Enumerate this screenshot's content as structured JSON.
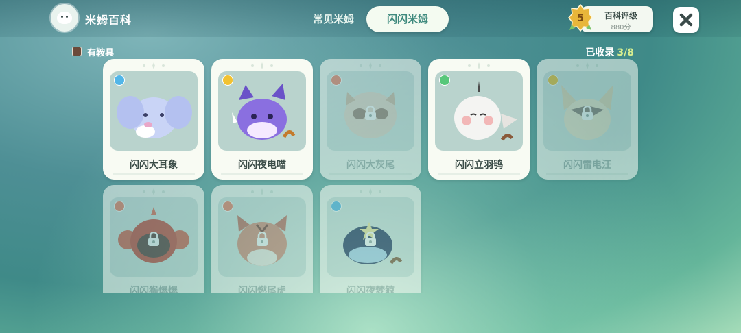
{
  "header": {
    "avatar_icon": "cat-avatar-icon",
    "title": "米姆百科",
    "tabs": [
      {
        "label": "常见米姆",
        "active": false
      },
      {
        "label": "闪闪米姆",
        "active": true
      }
    ],
    "rating": {
      "badge_level": "5",
      "label": "百科评级",
      "score": "880分"
    },
    "close_icon": "close-icon"
  },
  "filter": {
    "label": "有鞍具",
    "checked": true
  },
  "collection": {
    "label": "已收录",
    "count": "3/8"
  },
  "colors": {
    "water": "#52b6e8",
    "electric": "#f2c232",
    "fire": "#ef7f62",
    "grass": "#57c77a"
  },
  "cards": [
    {
      "name": "闪闪大耳象",
      "element": "water",
      "locked": false
    },
    {
      "name": "闪闪夜电喵",
      "element": "electric",
      "locked": false
    },
    {
      "name": "闪闪大灰尾",
      "element": "fire",
      "locked": true
    },
    {
      "name": "闪闪立羽鸮",
      "element": "grass",
      "locked": false
    },
    {
      "name": "闪闪雷电汪",
      "element": "electric",
      "locked": true
    },
    {
      "name": "闪闪猴爆爆",
      "element": "fire",
      "locked": true
    },
    {
      "name": "闪闪燃尾虎",
      "element": "fire",
      "locked": true
    },
    {
      "name": "闪闪夜梦鲸",
      "element": "water",
      "locked": true
    }
  ]
}
